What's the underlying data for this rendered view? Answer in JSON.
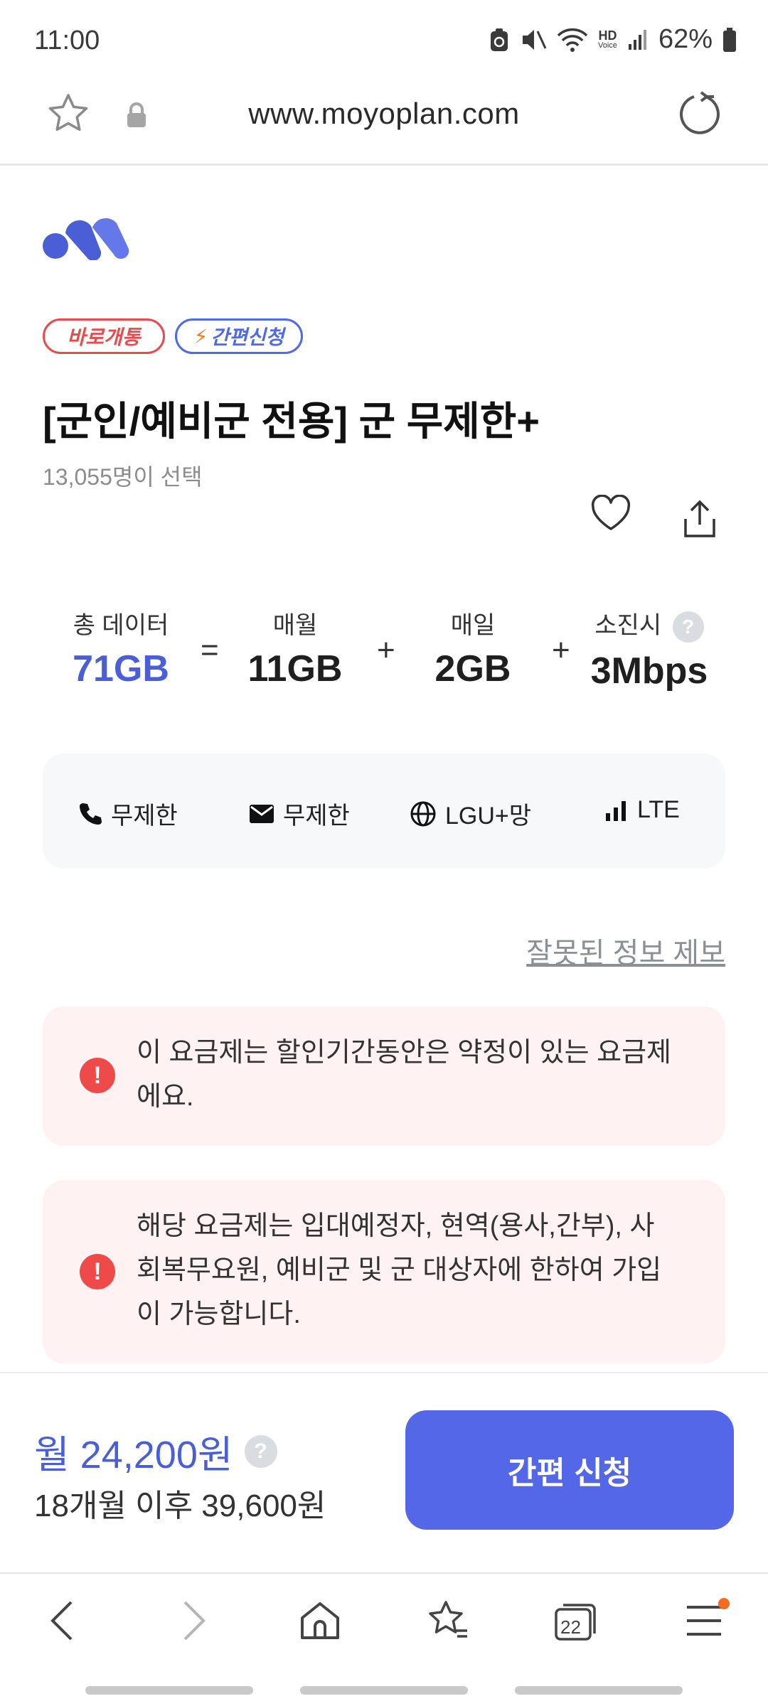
{
  "status": {
    "time": "11:00",
    "battery": "62%",
    "hd": "HD",
    "hd_sub": "Voice"
  },
  "browser": {
    "url": "www.moyoplan.com"
  },
  "badges": [
    {
      "label": "바로개통"
    },
    {
      "label": "간편신청"
    }
  ],
  "plan": {
    "title": "[군인/예비군 전용] 군 무제한+",
    "selected_count": "13,055명이 선택"
  },
  "data_summary": {
    "total": {
      "label": "총 데이터",
      "value": "71GB"
    },
    "monthly": {
      "label": "매월",
      "value": "11GB"
    },
    "daily": {
      "label": "매일",
      "value": "2GB"
    },
    "exhausted": {
      "label": "소진시",
      "value": "3Mbps"
    },
    "op_equals": "=",
    "op_plus": "+"
  },
  "features": [
    {
      "icon": "phone-icon",
      "label": "무제한"
    },
    {
      "icon": "mail-icon",
      "label": "무제한"
    },
    {
      "icon": "globe-icon",
      "label": "LGU+망"
    },
    {
      "icon": "signal-icon",
      "label": "LTE"
    }
  ],
  "report_link": "잘못된 정보 제보",
  "notices": [
    {
      "line1": "이 요금제는 할인기간동안은 약정이 있는 요금제",
      "line2": "에요."
    },
    {
      "line1": "해당 요금제는 입대예정자, 현역(용사,간부), 사",
      "line2": "회복무요원, 예비군 및 군 대상자에 한하여 가입",
      "line3": "이 가능합니다."
    }
  ],
  "pricing": {
    "monthly": "월 24,200원",
    "after": "18개월 이후 39,600원",
    "help": "?",
    "apply_label": "간편 신청"
  },
  "nav": {
    "tabs_count": "22"
  },
  "colors": {
    "accent": "#5468e7",
    "price_blue": "#4a5fd6",
    "warn_red": "#ef4a4a",
    "notice_bg": "#fff2f2"
  }
}
